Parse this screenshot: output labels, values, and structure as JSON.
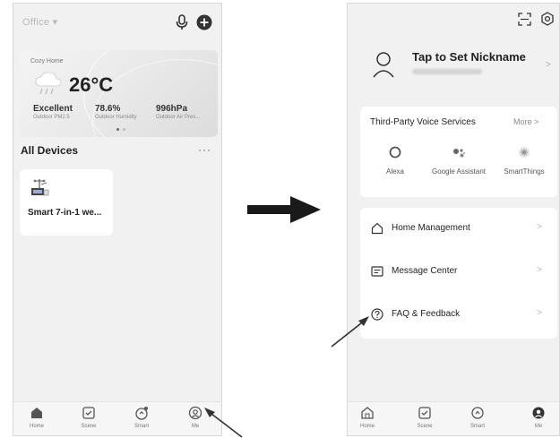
{
  "left_screen": {
    "home_name": "Office ▾",
    "icons": {
      "mic": "microphone-icon",
      "add": "plus-circle-icon"
    },
    "weather": {
      "location": "Cozy Home",
      "temperature": "26°C",
      "stats": [
        {
          "value": "Excellent",
          "label": "Outdoor PM2.5"
        },
        {
          "value": "78.6%",
          "label": "Outdoor Humidity"
        },
        {
          "value": "996hPa",
          "label": "Outdoor Air Pres..."
        }
      ]
    },
    "devices_title": "All Devices",
    "more": "···",
    "device": {
      "name": "Smart 7-in-1 we..."
    },
    "tabs": [
      {
        "label": "Home",
        "icon": "home-icon"
      },
      {
        "label": "Scene",
        "icon": "checkbox-icon"
      },
      {
        "label": "Smart",
        "icon": "smart-icon"
      },
      {
        "label": "Me",
        "icon": "person-circle-icon"
      }
    ]
  },
  "right_screen": {
    "profile": {
      "nickname": "Tap to Set Nickname",
      "chevron": ">"
    },
    "voice": {
      "title": "Third-Party Voice Services",
      "more": "More >",
      "services": [
        {
          "name": "Alexa",
          "icon": "alexa-icon"
        },
        {
          "name": "Google Assistant",
          "icon": "google-assistant-icon"
        },
        {
          "name": "SmartThings",
          "icon": "smartthings-icon"
        }
      ]
    },
    "menu": [
      {
        "label": "Home Management",
        "icon": "house-icon"
      },
      {
        "label": "Message Center",
        "icon": "message-icon"
      },
      {
        "label": "FAQ & Feedback",
        "icon": "question-icon"
      }
    ],
    "chevron": ">",
    "tabs": [
      {
        "label": "Home",
        "icon": "home-icon"
      },
      {
        "label": "Scene",
        "icon": "checkbox-icon"
      },
      {
        "label": "Smart",
        "icon": "smart-icon"
      },
      {
        "label": "Me",
        "icon": "person-circle-icon"
      }
    ]
  },
  "colors": {
    "background": "#f1f1f1",
    "card": "#ffffff",
    "text": "#222222",
    "muted": "#888888"
  }
}
